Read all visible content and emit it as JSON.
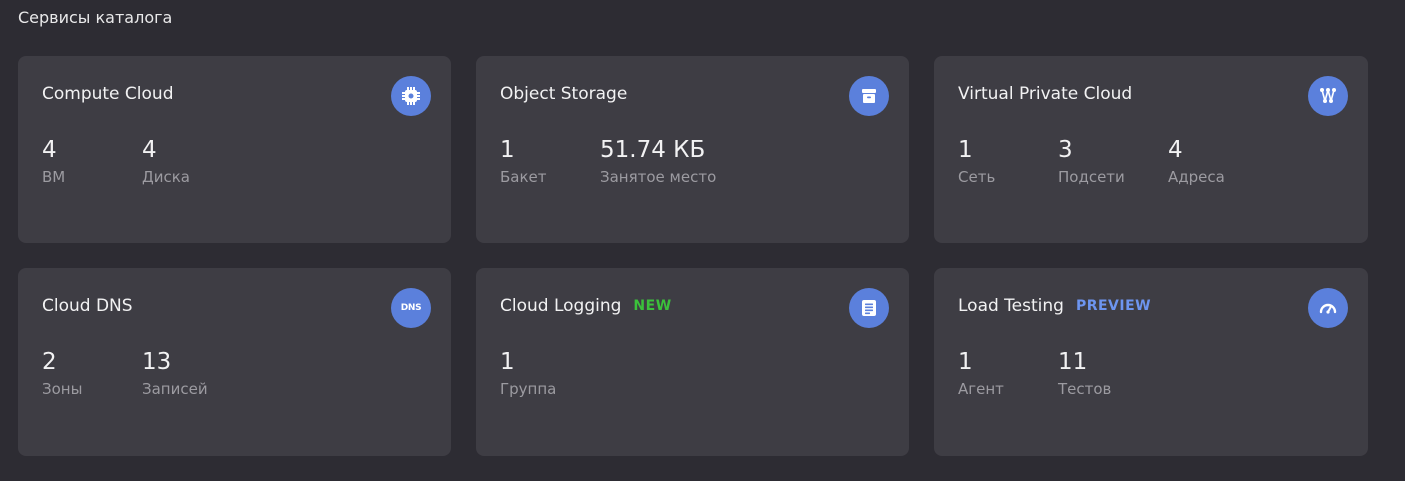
{
  "section": {
    "title": "Сервисы каталога"
  },
  "cards": [
    {
      "title": "Compute Cloud",
      "icon": "cpu-chip-icon",
      "stats": [
        {
          "value": "4",
          "label": "ВМ"
        },
        {
          "value": "4",
          "label": "Диска"
        }
      ]
    },
    {
      "title": "Object Storage",
      "icon": "storage-box-icon",
      "stats": [
        {
          "value": "1",
          "label": "Бакет"
        },
        {
          "value": "51.74 КБ",
          "label": "Занятое место"
        }
      ]
    },
    {
      "title": "Virtual Private Cloud",
      "icon": "network-icon",
      "stats": [
        {
          "value": "1",
          "label": "Сеть"
        },
        {
          "value": "3",
          "label": "Подсети"
        },
        {
          "value": "4",
          "label": "Адреса"
        }
      ]
    },
    {
      "title": "Cloud DNS",
      "icon": "dns-icon",
      "icon_text": "DNS",
      "stats": [
        {
          "value": "2",
          "label": "Зоны"
        },
        {
          "value": "13",
          "label": "Записей"
        }
      ]
    },
    {
      "title": "Cloud Logging",
      "badge": "NEW",
      "icon": "log-lines-icon",
      "stats": [
        {
          "value": "1",
          "label": "Группа"
        }
      ]
    },
    {
      "title": "Load Testing",
      "badge": "PREVIEW",
      "icon": "speedometer-icon",
      "stats": [
        {
          "value": "1",
          "label": "Агент"
        },
        {
          "value": "11",
          "label": "Тестов"
        }
      ]
    }
  ],
  "colors": {
    "background": "#2d2c33",
    "card": "#3e3d44",
    "icon_circle": "#5b80dc",
    "badge_new": "#3bc13b",
    "badge_preview": "#6d95f0"
  }
}
